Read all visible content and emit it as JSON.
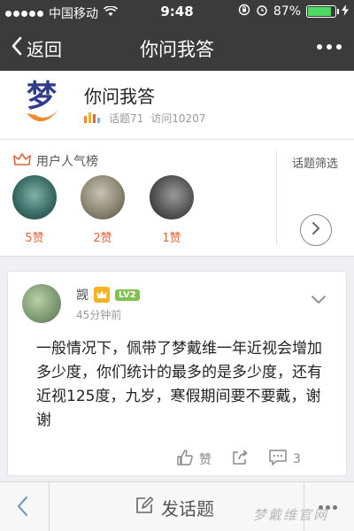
{
  "status_bar": {
    "carrier": "中国移动",
    "time": "9:48",
    "battery": "87%",
    "battery_level": 0.87,
    "icons": [
      "signal-dots-icon",
      "wifi-icon",
      "orientation-lock-icon",
      "alarm-icon",
      "battery-icon",
      "charging-icon"
    ]
  },
  "nav": {
    "back_label": "返回",
    "title": "你问我答",
    "more_icon": "more-dots-icon"
  },
  "topic": {
    "name": "你问我答",
    "topics_label": "话题71",
    "visits_label": "访问10207",
    "logo_char": "梦"
  },
  "popularity": {
    "heading": "用户人气榜",
    "filter_label": "话题筛选",
    "users": [
      {
        "likes": "5赞"
      },
      {
        "likes": "2赞"
      },
      {
        "likes": "1赞"
      }
    ]
  },
  "post": {
    "author": "觊",
    "level": "LV2",
    "time": "45分钟前",
    "body": "一般情况下，佩带了梦戴维一年近视会增加多少度，你们统计的最多的是多少度，还有近视125度，九岁，寒假期间要不要戴，谢谢",
    "like_label": "赞",
    "comment_count": "3"
  },
  "bottom_bar": {
    "post_label": "发话题",
    "watermark": "梦戴维官网"
  },
  "colors": {
    "bar_bg": "#3b3b3b",
    "accent_orange": "#e0653a",
    "level_green": "#83c14f",
    "crown_gold": "#f5b321",
    "battery_green": "#4cd964"
  }
}
